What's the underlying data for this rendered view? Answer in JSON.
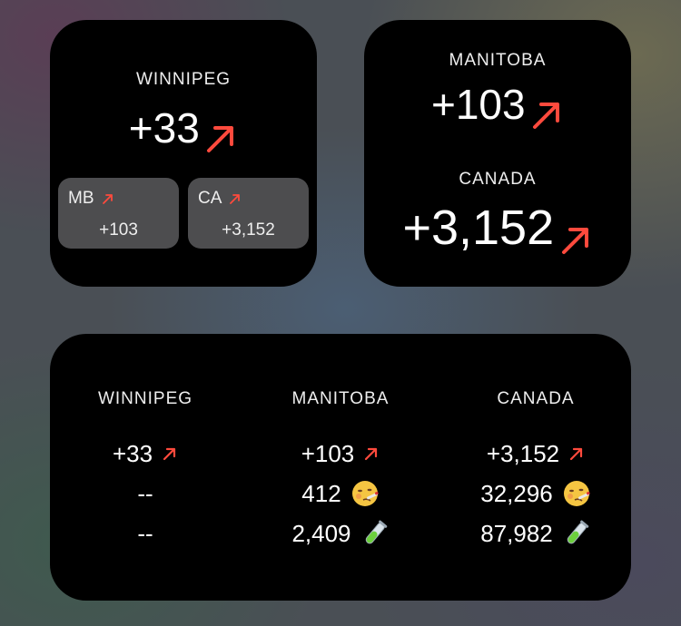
{
  "widgets": {
    "small_left": {
      "label": "WINNIPEG",
      "value": "+33",
      "sub_mb": {
        "label": "MB",
        "value": "+103"
      },
      "sub_ca": {
        "label": "CA",
        "value": "+3,152"
      }
    },
    "small_right": {
      "label1": "MANITOBA",
      "value1": "+103",
      "label2": "CANADA",
      "value2": "+3,152"
    },
    "wide": {
      "columns": [
        {
          "label": "WINNIPEG",
          "new": "+33",
          "active": "--",
          "tests": "--"
        },
        {
          "label": "MANITOBA",
          "new": "+103",
          "active": "412",
          "tests": "2,409"
        },
        {
          "label": "CANADA",
          "new": "+3,152",
          "active": "32,296",
          "tests": "87,982"
        }
      ]
    }
  },
  "icons": {
    "trend": "arrow-up-right-icon",
    "active": "sick-face-icon",
    "tests": "test-tube-icon"
  },
  "colors": {
    "accent_red": "#ff4a3d",
    "widget_bg": "#000000",
    "sub_card_bg": "#4d4d4f",
    "test_tube_green": "#6ccf3d"
  }
}
